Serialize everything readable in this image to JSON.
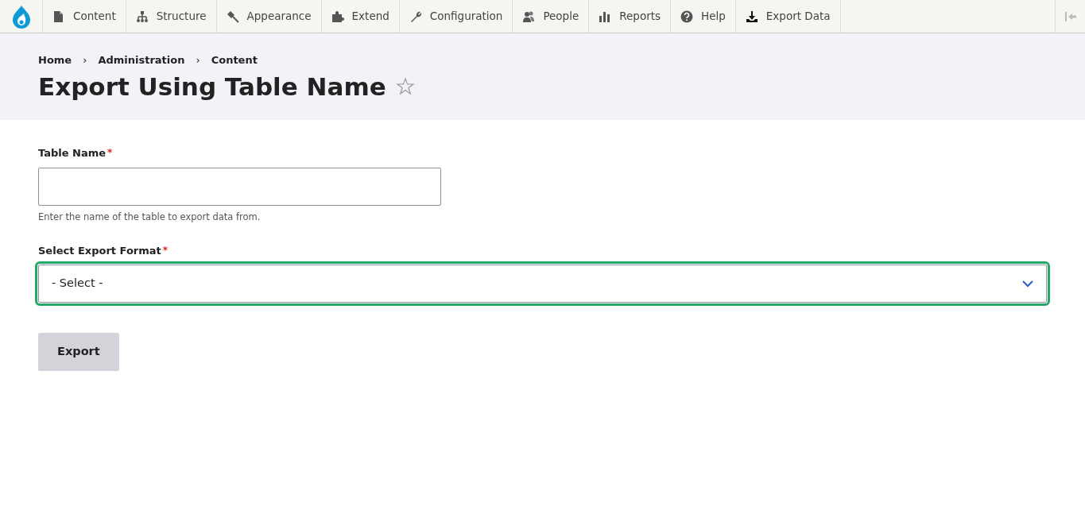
{
  "toolbar": {
    "items": [
      {
        "label": "Content"
      },
      {
        "label": "Structure"
      },
      {
        "label": "Appearance"
      },
      {
        "label": "Extend"
      },
      {
        "label": "Configuration"
      },
      {
        "label": "People"
      },
      {
        "label": "Reports"
      },
      {
        "label": "Help"
      },
      {
        "label": "Export Data"
      }
    ]
  },
  "breadcrumb": [
    {
      "label": "Home"
    },
    {
      "label": "Administration"
    },
    {
      "label": "Content"
    }
  ],
  "breadcrumb_separator": "›",
  "page_title": "Export Using Table Name",
  "form": {
    "fields": [
      {
        "kind": "text",
        "label": "Table Name",
        "required_mark": "*",
        "description": "Enter the name of the table to export data from.",
        "focused": false
      },
      {
        "kind": "select",
        "label": "Select Export Format",
        "required_mark": "*",
        "value": "- Select -",
        "focused": true
      }
    ],
    "submit": "Export"
  }
}
